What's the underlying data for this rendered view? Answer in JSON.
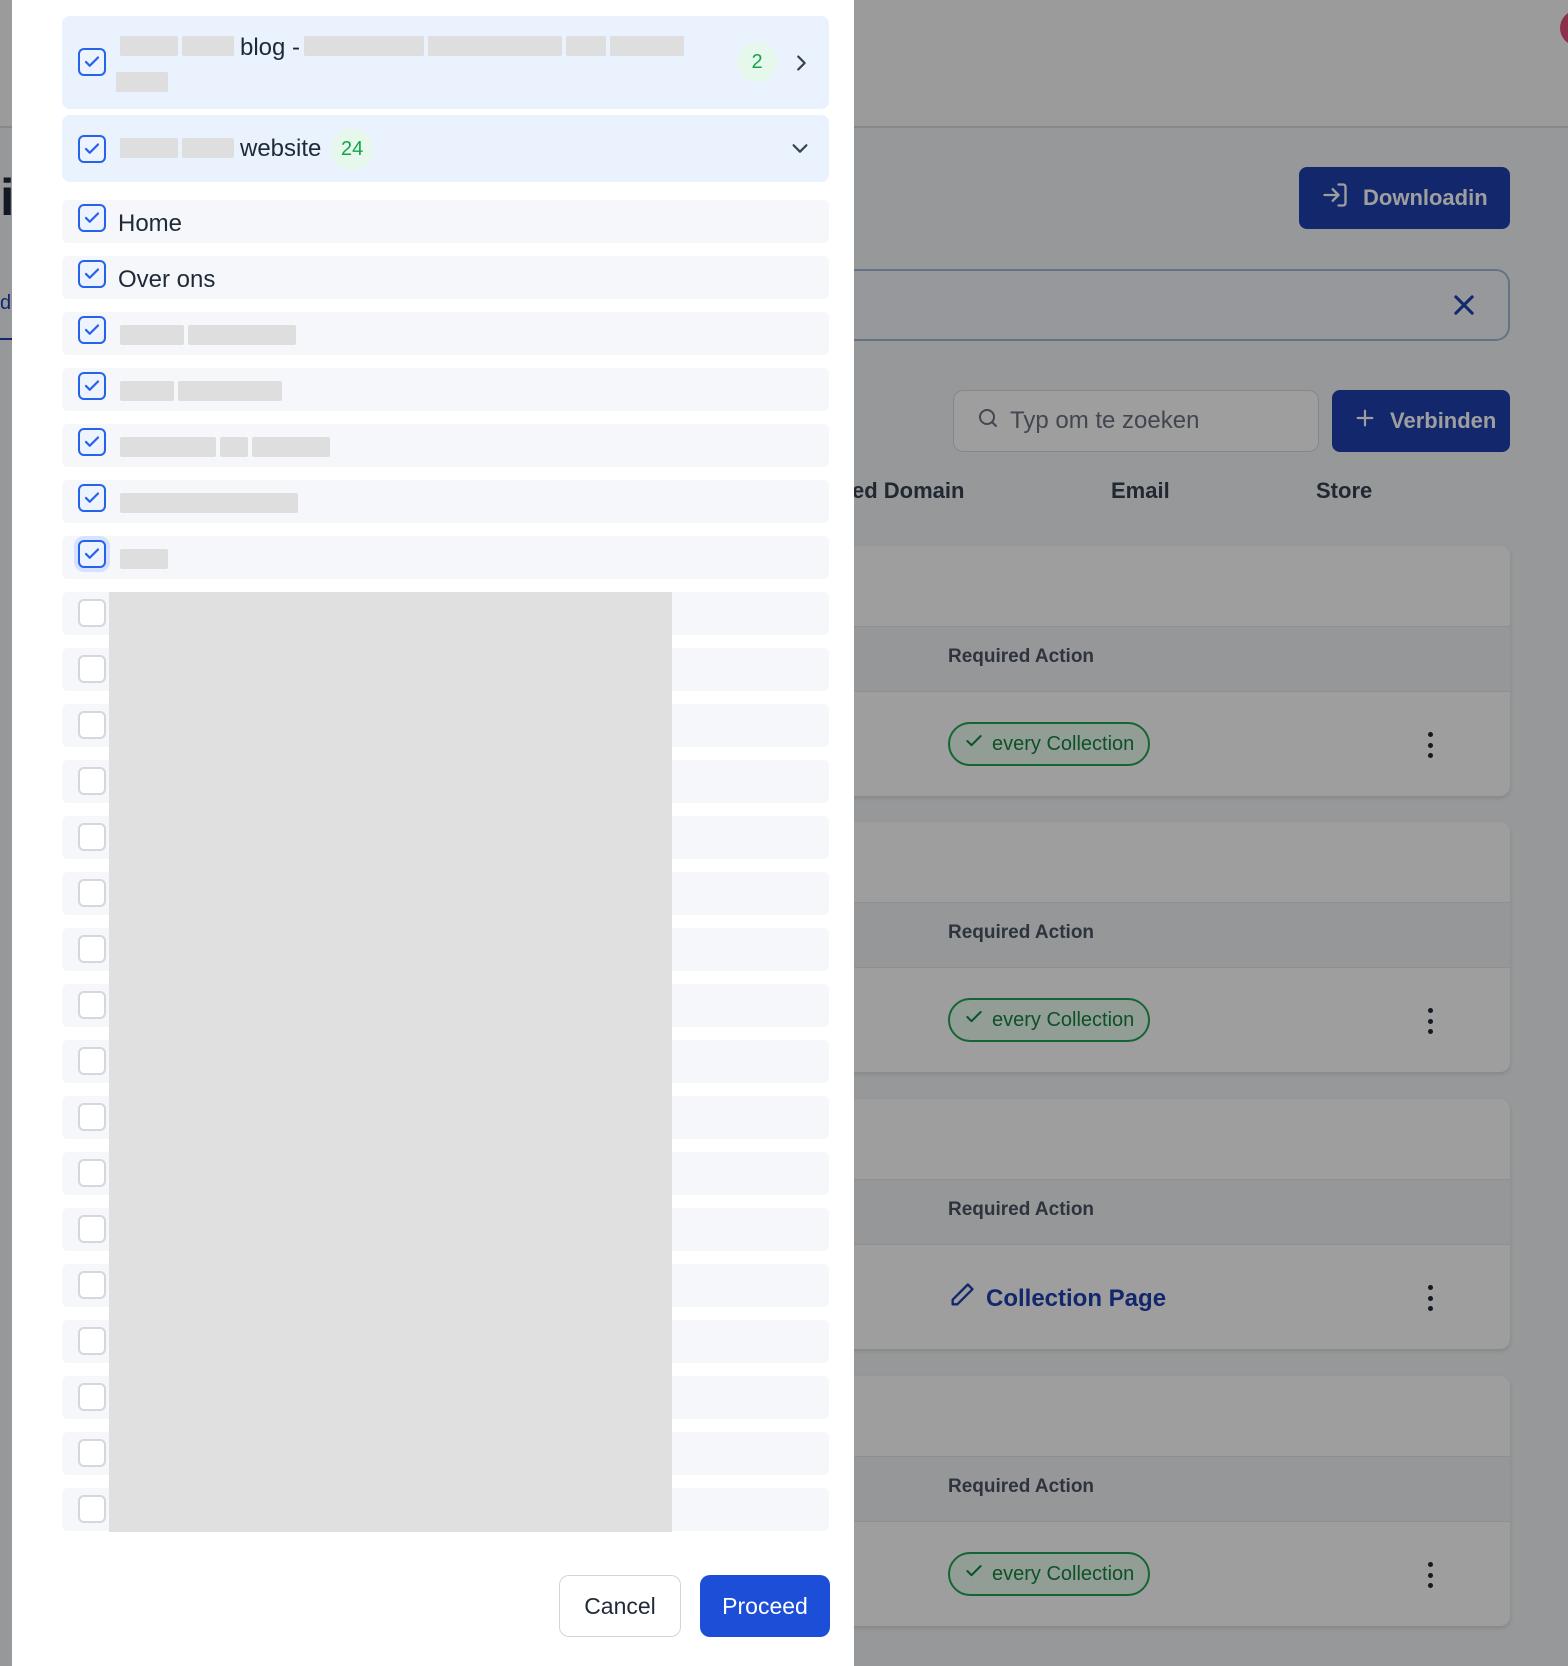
{
  "background": {
    "heading_fragment": "i",
    "link_fragment": "d",
    "download_button": "Downloadin",
    "search": {
      "placeholder": "Typ om te zoeken"
    },
    "connect_button": "Verbinden",
    "columns": [
      "ed Domain",
      "Email",
      "Store"
    ],
    "cards": [
      {
        "required_label": "Required Action",
        "action_type": "pill",
        "action_text": "every Collection"
      },
      {
        "required_label": "Required Action",
        "action_type": "pill",
        "action_text": "every Collection"
      },
      {
        "required_label": "Required Action",
        "action_type": "link",
        "action_text": "Collection Page"
      },
      {
        "required_label": "Required Action",
        "action_type": "pill",
        "action_text": "every Collection"
      }
    ],
    "colors": {
      "primary": "#1e40af",
      "success": "#16833f"
    }
  },
  "modal": {
    "groups": [
      {
        "label": "blog -",
        "count": "2",
        "expanded": false,
        "checked": true
      },
      {
        "label": "website",
        "count": "24",
        "expanded": true,
        "checked": true
      }
    ],
    "pages": [
      {
        "label": "Home",
        "checked": true
      },
      {
        "label": "Over ons",
        "checked": true
      },
      {
        "label": "",
        "checked": true
      },
      {
        "label": "",
        "checked": true
      },
      {
        "label": "",
        "checked": true
      },
      {
        "label": "",
        "checked": true
      },
      {
        "label": "",
        "checked": true
      }
    ],
    "unchecked_rows": 17,
    "cancel_button": "Cancel",
    "proceed_button": "Proceed",
    "colors": {
      "check": "#2563eb",
      "badge_text": "#16a34a",
      "proceed": "#1d4ed8"
    }
  }
}
